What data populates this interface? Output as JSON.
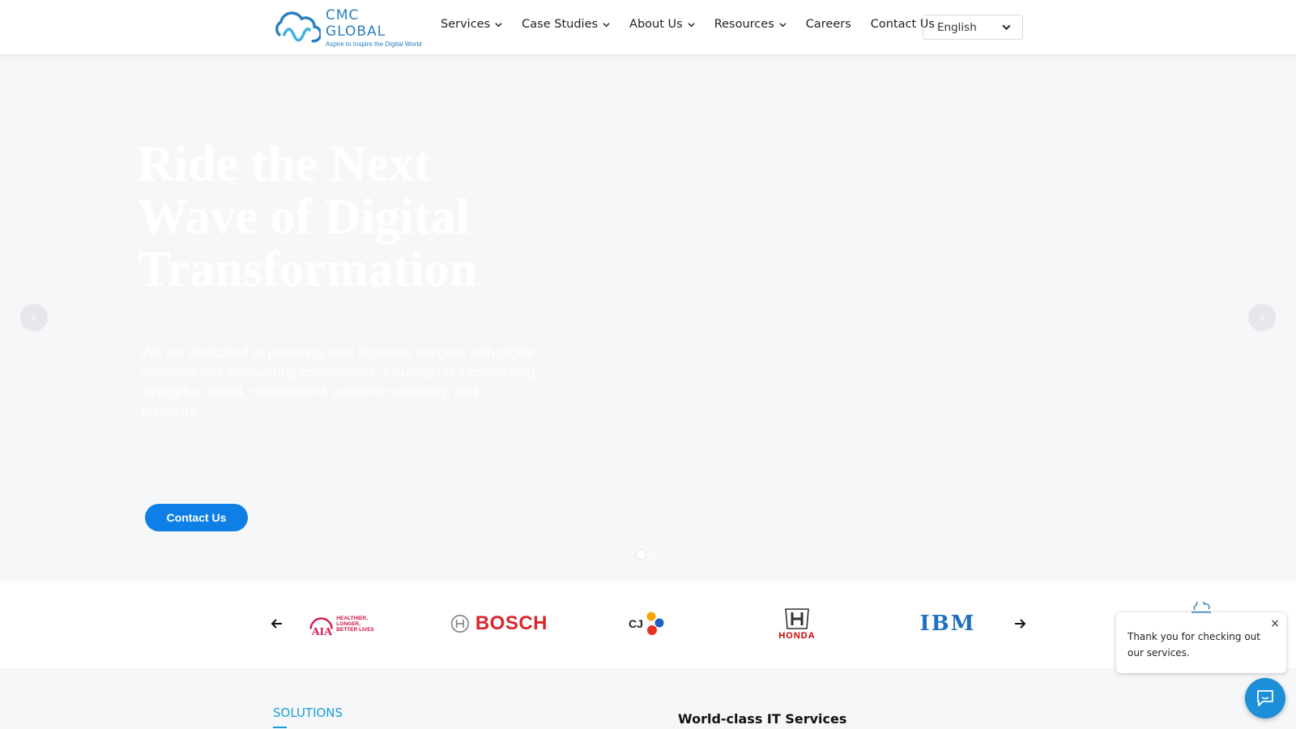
{
  "header": {
    "logo_name": "CMC GLOBAL",
    "logo_tagline": "Aspire to Inspire the Digital World",
    "nav": [
      {
        "label": "Services",
        "dropdown": true
      },
      {
        "label": "Case Studies",
        "dropdown": true
      },
      {
        "label": "About Us",
        "dropdown": true
      },
      {
        "label": "Resources",
        "dropdown": true
      },
      {
        "label": "Careers",
        "dropdown": false
      },
      {
        "label": "Contact Us",
        "dropdown": false
      }
    ],
    "language": "English"
  },
  "hero": {
    "title": "Ride the Next Wave of Digital Transformation",
    "description": "We are dedicated to powering your business success with digital solutions and unwavering commitment, focusing on 4 compelling strengths: speed, commitment, customer centricity, and creativity.",
    "cta": "Contact Us",
    "prev_arrow": "‹",
    "next_arrow": "›",
    "slides": 2,
    "active_slide": 1
  },
  "clients": {
    "logos": [
      "AIA",
      "BOSCH",
      "CJ",
      "HONDA",
      "IBM"
    ],
    "aia_tagline_1": "HEALTHIER, LONGER,",
    "aia_tagline_2": "BETTER LIVES",
    "cj_text": "CJ"
  },
  "section": {
    "label": "SOLUTIONS",
    "heading": "World-class IT Services"
  },
  "chat": {
    "popup_text": "Thank you for checking out our services.",
    "close_symbol": "×"
  },
  "colors": {
    "brand_blue": "#2a7fbf",
    "cta_blue": "#0d7fe6",
    "accent_cyan": "#1a9fd6",
    "bosch_red": "#d9262e",
    "honda_red": "#cc0000",
    "ibm_blue": "#1f70c1"
  }
}
